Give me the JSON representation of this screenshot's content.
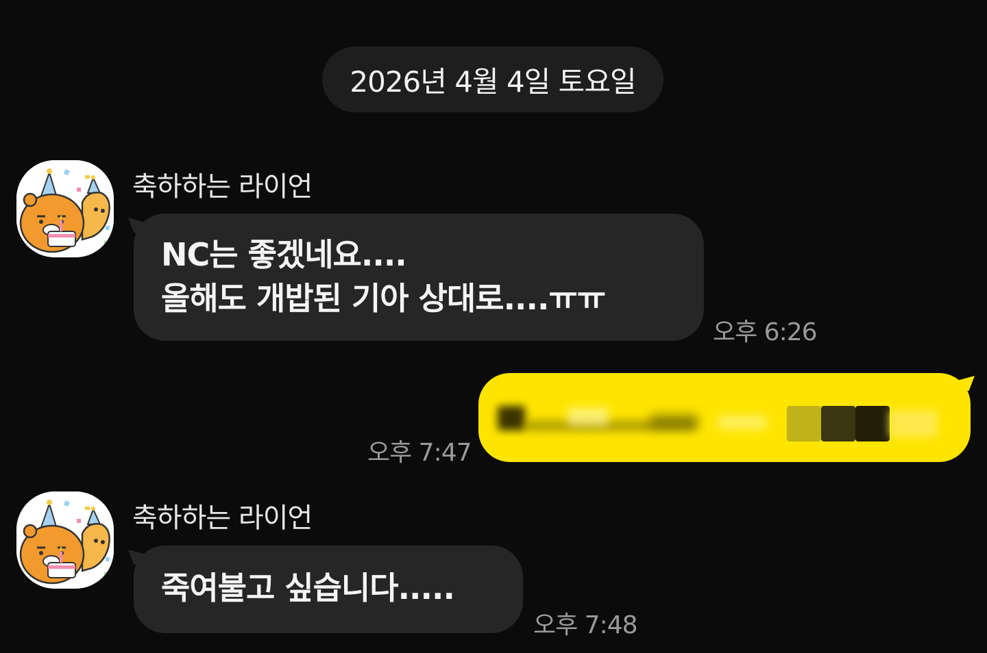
{
  "date_divider": "2026년 4월 4일 토요일",
  "messages": [
    {
      "sender": "축하하는 라이언",
      "avatar_icon": "celebrating-ryan-icon",
      "lines": [
        "NC는 좋겠네요....",
        "올해도 개밥된 기아 상대로....ㅠㅠ"
      ],
      "time": "오후 6:26"
    },
    {
      "sender": "",
      "outgoing": true,
      "redacted": true,
      "time": "오후 7:47"
    },
    {
      "sender": "축하하는 라이언",
      "avatar_icon": "celebrating-ryan-icon",
      "lines": [
        "죽여불고 싶습니다....."
      ],
      "time": "오후 7:48"
    }
  ],
  "colors": {
    "background": "#0b0b0b",
    "incoming_bubble": "#262626",
    "outgoing_bubble": "#fee500",
    "date_pill": "#1e1e1e",
    "time_text": "#9a9a9a"
  }
}
